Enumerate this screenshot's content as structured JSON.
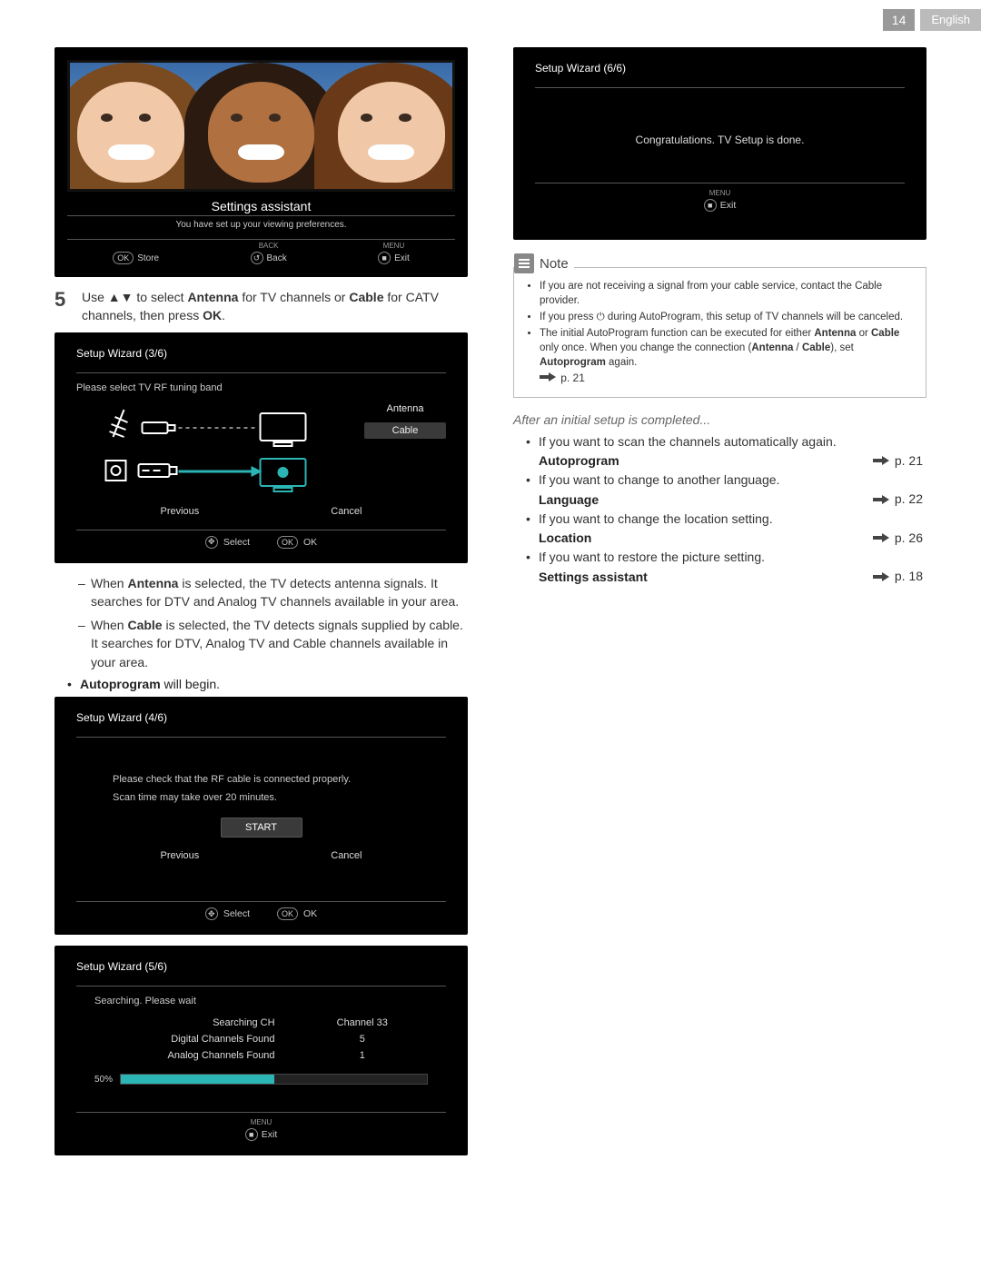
{
  "header": {
    "page_number": "14",
    "language": "English"
  },
  "panel_assist": {
    "title": "Settings assistant",
    "subtitle": "You have set up your viewing preferences.",
    "foot_store_key": "OK",
    "foot_store": "Store",
    "foot_back_top": "BACK",
    "foot_back": "Back",
    "foot_exit_top": "MENU",
    "foot_exit": "Exit"
  },
  "step5": {
    "number": "5",
    "prefix": "Use ",
    "arrows": "▲▼",
    "mid1": " to select ",
    "b1": "Antenna",
    "mid2": " for TV channels or ",
    "b2": "Cable",
    "mid3": " for CATV channels, then press ",
    "b3": "OK",
    "end": "."
  },
  "panel_3of6": {
    "title": "Setup Wizard (3/6)",
    "sub": "Please select TV RF tuning band",
    "opt_antenna": "Antenna",
    "opt_cable": "Cable",
    "previous": "Previous",
    "cancel": "Cancel",
    "foot_select": "Select",
    "foot_ok_key": "OK",
    "foot_ok": "OK"
  },
  "dash_1_a": "When ",
  "dash_1_b": "Antenna",
  "dash_1_c": " is selected, the TV detects antenna signals. It searches for DTV and Analog TV channels available in your area.",
  "dash_2_a": "When ",
  "dash_2_b": "Cable",
  "dash_2_c": " is selected, the TV detects signals supplied by cable. It searches for DTV, Analog TV and Cable channels available in your area.",
  "dot_a": "Autoprogram",
  "dot_b": " will begin.",
  "panel_4of6": {
    "title": "Setup Wizard (4/6)",
    "line1": "Please check that the RF cable is connected properly.",
    "line2": "Scan time may take over 20 minutes.",
    "start": "START",
    "previous": "Previous",
    "cancel": "Cancel",
    "foot_select": "Select",
    "foot_ok_key": "OK",
    "foot_ok": "OK"
  },
  "panel_5of6": {
    "title": "Setup Wizard (5/6)",
    "searching": "Searching. Please wait",
    "rows": [
      {
        "k": "Searching CH",
        "v": "Channel 33"
      },
      {
        "k": "Digital Channels Found",
        "v": "5"
      },
      {
        "k": "Analog Channels Found",
        "v": "1"
      }
    ],
    "percent_label": "50%",
    "percent": 50,
    "foot_menu": "MENU",
    "foot_exit": "Exit"
  },
  "panel_6of6": {
    "title": "Setup Wizard (6/6)",
    "message": "Congratulations. TV Setup is done.",
    "foot_menu": "MENU",
    "foot_exit": "Exit"
  },
  "note": {
    "label": "Note",
    "items": [
      "If you are not receiving a signal from your cable service, contact the Cable provider.",
      "If you press ⏻ during AutoProgram, this setup of TV channels will be canceled.",
      "The initial AutoProgram function can be executed for either Antenna or Cable only once. When you change the connection (Antenna / Cable), set Autoprogram again."
    ],
    "bold_map": {
      "2": [
        "Antenna",
        "Cable",
        "Autoprogram"
      ]
    },
    "item3_page": "p. 21"
  },
  "after_heading": "After an initial setup is completed...",
  "after": [
    {
      "text": "If you want to scan the channels automatically again.",
      "label": "Autoprogram",
      "page": "p. 21"
    },
    {
      "text": "If you want to change to another language.",
      "label": "Language",
      "page": "p. 22"
    },
    {
      "text": "If you want to change the location setting.",
      "label": "Location",
      "page": "p. 26"
    },
    {
      "text": "If you want to restore the picture setting.",
      "label": "Settings assistant",
      "page": "p. 18"
    }
  ]
}
